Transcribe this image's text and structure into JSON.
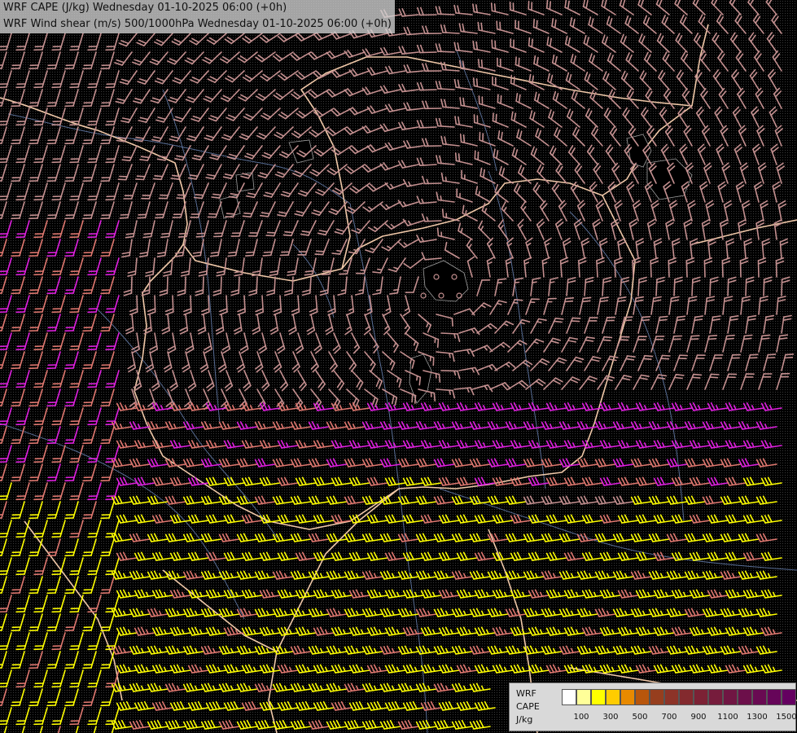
{
  "titles": {
    "line1": "WRF CAPE (J/kg) Wednesday 01-10-2025 06:00 (+0h)",
    "line2": "WRF Wind shear (m/s) 500/1000hPa Wednesday 01-10-2025 06:00 (+0h)"
  },
  "legend": {
    "model": "WRF",
    "field": "CAPE",
    "unit": "J/kg",
    "colors": [
      "#ffffff",
      "#ffff99",
      "#ffff00",
      "#ffcc00",
      "#e88a00",
      "#b8560c",
      "#963e1e",
      "#8c3328",
      "#832a2e",
      "#7c2235",
      "#761c3c",
      "#701643",
      "#6c0f4a",
      "#690a52",
      "#660559",
      "#640060"
    ],
    "ticks": [
      "100",
      "300",
      "500",
      "700",
      "900",
      "1100",
      "1300",
      "1500"
    ]
  },
  "colors": {
    "background": "#000000",
    "border": "#f0c8a8",
    "river": "#6b86b8",
    "barb_light": "#c49090",
    "barb_mid": "#e07870",
    "barb_magenta": "#e020e0",
    "barb_yellow": "#ffff00",
    "contour": "#a0a0a0"
  },
  "map_symbols": {
    "barb": "wind-barb",
    "calm": "calm-circle"
  }
}
